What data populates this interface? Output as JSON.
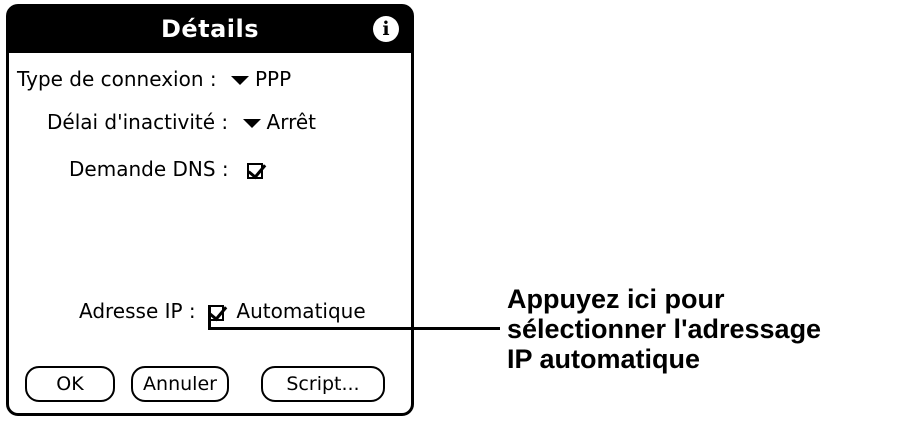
{
  "dialog": {
    "title": "Détails",
    "info_icon": "info-icon",
    "connection_type": {
      "label": "Type de connexion :",
      "value": "PPP"
    },
    "idle_timeout": {
      "label": "Délai d'inactivité :",
      "value": "Arrêt"
    },
    "dns_query": {
      "label": "Demande DNS :",
      "checked": true
    },
    "ip_address": {
      "label": "Adresse IP :",
      "checked": true,
      "value": "Automatique"
    },
    "buttons": {
      "ok": "OK",
      "cancel": "Annuler",
      "script": "Script..."
    }
  },
  "callout": {
    "line1": "Appuyez ici pour",
    "line2": "sélectionner l'adressage",
    "line3": "IP automatique"
  }
}
